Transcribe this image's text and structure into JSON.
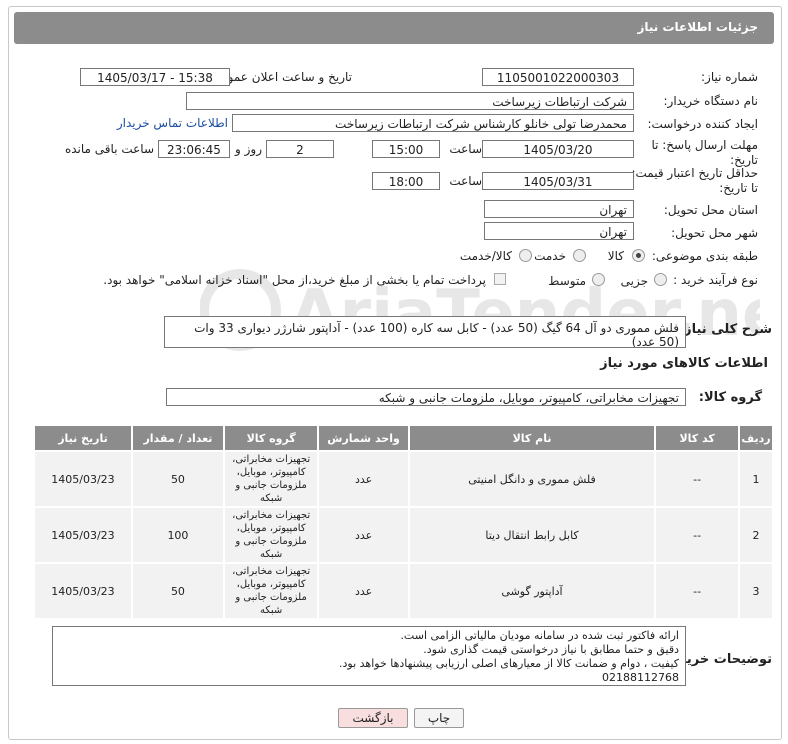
{
  "header": {
    "title": "جزئیات اطلاعات نیاز"
  },
  "fields": {
    "need_number_label": "شماره نیاز:",
    "need_number": "1105001022000303",
    "announce_label": "تاریخ و ساعت اعلان عمومی:",
    "announce_value": "1405/03/17 - 15:38",
    "buyer_org_label": "نام دستگاه خریدار:",
    "buyer_org": "شرکت ارتباطات زیرساخت",
    "creator_label": "ایجاد کننده درخواست:",
    "creator": "محمدرضا تولی خانلو کارشناس شرکت ارتباطات زیرساخت",
    "contact_link": "اطلاعات تماس خریدار",
    "deadline_label": "مهلت ارسال پاسخ: تا تاریخ:",
    "deadline_date": "1405/03/20",
    "time_label": "ساعت",
    "deadline_time": "15:00",
    "days_value": "2",
    "days_label": "روز و",
    "remaining_time": "23:06:45",
    "remaining_label": "ساعت باقی مانده",
    "price_validity_label": "حداقل تاریخ اعتبار قیمت: تا تاریخ:",
    "price_validity_date": "1405/03/31",
    "price_validity_time": "18:00",
    "province_label": "استان محل تحویل:",
    "province": "تهران",
    "city_label": "شهر محل تحویل:",
    "city": "تهران",
    "category_label": "طبقه بندی موضوعی:",
    "category_options": [
      "کالا",
      "خدمت",
      "کالا/خدمت"
    ],
    "process_label": "نوع فرآیند خرید :",
    "process_options": [
      "جزیی",
      "متوسط"
    ],
    "payment_note": "پرداخت تمام یا بخشی از مبلغ خرید،از محل \"اسناد خزانه اسلامی\" خواهد بود."
  },
  "description": {
    "label": "شرح کلی نیاز:",
    "text": "فلش مموری دو آل 64 گیگ (50 عدد) - کابل سه کاره (100 عدد) - آداپتور شارژر دیواری 33 وات (50 عدد)"
  },
  "goods": {
    "section_title": "اطلاعات کالاهای مورد نیاز",
    "group_label": "گروه کالا:",
    "group_value": "تجهیزات مخابراتی، کامپیوتر، موبایل، ملزومات جانبی و شبکه"
  },
  "table": {
    "headers": [
      "ردیف",
      "کد کالا",
      "نام کالا",
      "واحد شمارش",
      "گروه کالا",
      "تعداد / مقدار",
      "تاریخ نیاز"
    ],
    "rows": [
      {
        "row": "1",
        "code": "--",
        "name": "فلش مموری و دانگل امنیتی",
        "unit": "عدد",
        "group": "تجهیزات مخابراتی، کامپیوتر، موبایل، ملزومات جانبی و شبکه",
        "qty": "50",
        "date": "1405/03/23"
      },
      {
        "row": "2",
        "code": "--",
        "name": "کابل رابط انتقال دیتا",
        "unit": "عدد",
        "group": "تجهیزات مخابراتی، کامپیوتر، موبایل، ملزومات جانبی و شبکه",
        "qty": "100",
        "date": "1405/03/23"
      },
      {
        "row": "3",
        "code": "--",
        "name": "آداپتور گوشی",
        "unit": "عدد",
        "group": "تجهیزات مخابراتی، کامپیوتر، موبایل، ملزومات جانبی و شبکه",
        "qty": "50",
        "date": "1405/03/23"
      }
    ]
  },
  "buyer_notes": {
    "label": "توضیحات خریدار:",
    "lines": [
      "ارائه فاکتور ثبت شده در سامانه مودیان مالیاتی الزامی است.",
      "دقیق و حتما مطابق با نیاز درخواستی قیمت گذاری شود.",
      "کیفیت ، دوام و ضمانت کالا از معیارهای اصلی ارزیابی پیشنهادها خواهد بود.",
      "02188112768"
    ]
  },
  "buttons": {
    "print": "چاپ",
    "back": "بازگشت"
  },
  "watermark_text": "AriaTender.net",
  "colors": {
    "header": "#8c8c8c",
    "back_button": "#f8dede",
    "link": "#1a4fa0"
  }
}
